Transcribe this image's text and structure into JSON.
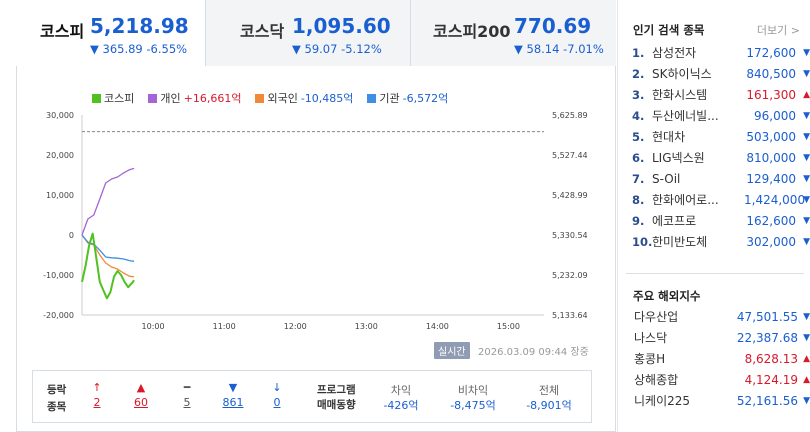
{
  "tabs": [
    {
      "name": "코스피",
      "value": "5,218.98",
      "change": "▼ 365.89 -6.55%"
    },
    {
      "name": "코스닥",
      "value": "1,095.60",
      "change": "▼ 59.07 -5.12%"
    },
    {
      "name": "코스피200",
      "value": "770.69",
      "change": "▼ 58.14 -7.01%"
    }
  ],
  "legend": {
    "kospi": "코스피",
    "individual": "개인",
    "individual_val": "+16,661억",
    "foreign": "외국인",
    "foreign_val": "-10,485억",
    "inst": "기관",
    "inst_val": "-6,572억"
  },
  "colors": {
    "kospi": "#4fc21f",
    "individual": "#a266d6",
    "foreign": "#f0893a",
    "inst": "#3f8fe2",
    "up": "#d7192a",
    "down": "#1a5fd0"
  },
  "chart_data": {
    "type": "line",
    "x_ticks": [
      "10:00",
      "11:00",
      "12:00",
      "13:00",
      "14:00",
      "15:00"
    ],
    "y_left_ticks": [
      "30,000",
      "20,000",
      "10,000",
      "0",
      "-10,000",
      "-20,000"
    ],
    "y_right_ticks": [
      "5,625.89",
      "5,527.44",
      "5,428.99",
      "5,330.54",
      "5,232.09",
      "5,133.64"
    ],
    "ylim_left": [
      -20000,
      30000
    ],
    "ylim_right": [
      5133.64,
      5625.89
    ],
    "reference_right": 5584.87,
    "time_start": "09:00",
    "series": [
      {
        "name": "개인",
        "axis": "left",
        "x": [
          "09:00",
          "09:05",
          "09:10",
          "09:15",
          "09:20",
          "09:25",
          "09:30",
          "09:35",
          "09:40",
          "09:44"
        ],
        "y": [
          0,
          4000,
          5000,
          9000,
          13000,
          14000,
          14500,
          15500,
          16300,
          16661
        ]
      },
      {
        "name": "외국인",
        "axis": "left",
        "x": [
          "09:00",
          "09:05",
          "09:10",
          "09:15",
          "09:20",
          "09:25",
          "09:30",
          "09:35",
          "09:40",
          "09:44"
        ],
        "y": [
          0,
          -2000,
          -2500,
          -5000,
          -7000,
          -8000,
          -8500,
          -9500,
          -10300,
          -10485
        ]
      },
      {
        "name": "기관",
        "axis": "left",
        "x": [
          "09:00",
          "09:05",
          "09:10",
          "09:15",
          "09:20",
          "09:25",
          "09:30",
          "09:35",
          "09:40",
          "09:44"
        ],
        "y": [
          0,
          -1800,
          -2300,
          -3800,
          -5500,
          -5700,
          -5800,
          -6000,
          -6400,
          -6572
        ]
      },
      {
        "name": "코스피",
        "axis": "right",
        "x": [
          "09:00",
          "09:03",
          "09:06",
          "09:09",
          "09:12",
          "09:15",
          "09:18",
          "09:21",
          "09:24",
          "09:27",
          "09:30",
          "09:33",
          "09:36",
          "09:39",
          "09:42",
          "09:44"
        ],
        "y": [
          5215,
          5255,
          5305,
          5334,
          5276,
          5215,
          5195,
          5175,
          5190,
          5228,
          5242,
          5232,
          5215,
          5202,
          5212,
          5218.98
        ]
      }
    ]
  },
  "footer": {
    "realtime": "실시간",
    "datetime": "2026.03.09 09:44 장중"
  },
  "stats": {
    "label1": "등락",
    "label2": "종목",
    "items": [
      {
        "icon": "↑",
        "value": "2",
        "color": "#d7192a"
      },
      {
        "icon": "▲",
        "value": "60",
        "color": "#d7192a"
      },
      {
        "icon": "━",
        "value": "5",
        "color": "#555"
      },
      {
        "icon": "▼",
        "value": "861",
        "color": "#1a5fd0"
      },
      {
        "icon": "↓",
        "value": "0",
        "color": "#1a5fd0"
      }
    ],
    "program_label1": "프로그램",
    "program_label2": "매매동향",
    "program": [
      {
        "head": "차익",
        "value": "-426억"
      },
      {
        "head": "비차익",
        "value": "-8,475억"
      },
      {
        "head": "전체",
        "value": "-8,901억"
      }
    ]
  },
  "popular": {
    "title": "인기 검색 종목",
    "more": "더보기",
    "items": [
      {
        "no": "1.",
        "name": "삼성전자",
        "price": "172,600",
        "dir": "down"
      },
      {
        "no": "2.",
        "name": "SK하이닉스",
        "price": "840,500",
        "dir": "down"
      },
      {
        "no": "3.",
        "name": "한화시스템",
        "price": "161,300",
        "dir": "up"
      },
      {
        "no": "4.",
        "name": "두산에너빌...",
        "price": "96,000",
        "dir": "down"
      },
      {
        "no": "5.",
        "name": "현대차",
        "price": "503,000",
        "dir": "down"
      },
      {
        "no": "6.",
        "name": "LIG넥스원",
        "price": "810,000",
        "dir": "down"
      },
      {
        "no": "7.",
        "name": "S-Oil",
        "price": "129,400",
        "dir": "down"
      },
      {
        "no": "8.",
        "name": "한화에어로...",
        "price": "1,424,000",
        "dir": "down"
      },
      {
        "no": "9.",
        "name": "에코프로",
        "price": "162,600",
        "dir": "down"
      },
      {
        "no": "10.",
        "name": "한미반도체",
        "price": "302,000",
        "dir": "down"
      }
    ]
  },
  "overseas": {
    "title": "주요 해외지수",
    "items": [
      {
        "name": "다우산업",
        "price": "47,501.55",
        "dir": "down"
      },
      {
        "name": "나스닥",
        "price": "22,387.68",
        "dir": "down"
      },
      {
        "name": "홍콩H",
        "price": "8,628.13",
        "dir": "up"
      },
      {
        "name": "상해종합",
        "price": "4,124.19",
        "dir": "up"
      },
      {
        "name": "니케이225",
        "price": "52,161.56",
        "dir": "down"
      }
    ]
  }
}
